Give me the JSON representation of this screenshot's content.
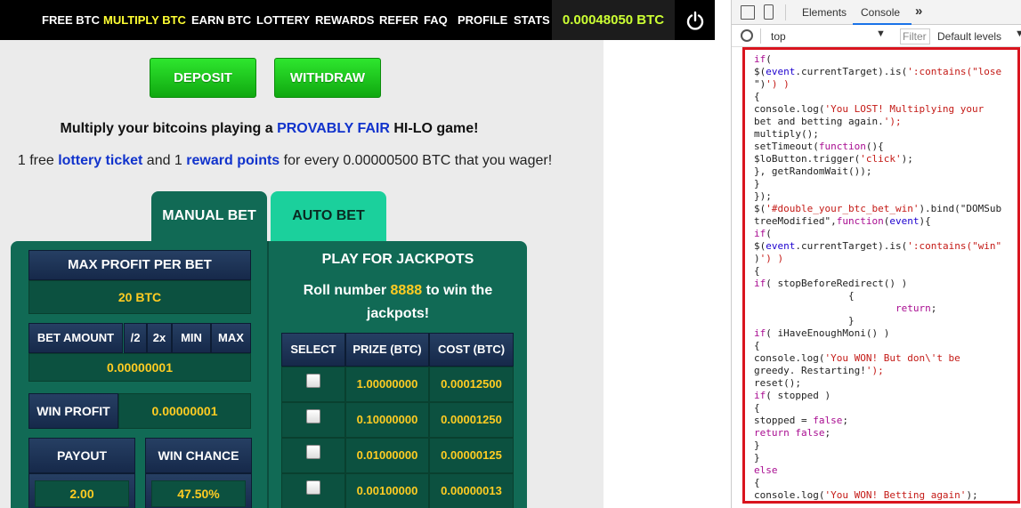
{
  "nav": {
    "items": [
      "FREE BTC",
      "MULTIPLY BTC",
      "EARN BTC",
      "LOTTERY",
      "REWARDS",
      "REFER",
      "FAQ",
      "PROFILE",
      "STATS"
    ],
    "active": "MULTIPLY BTC",
    "balance": "0.00048050 BTC"
  },
  "buttons": {
    "deposit": "DEPOSIT",
    "withdraw": "WITHDRAW"
  },
  "headline": {
    "pre": "Multiply your bitcoins playing a ",
    "highlight": "PROVABLY FAIR",
    "post": " HI-LO game!"
  },
  "subline": {
    "p1": "1 free ",
    "link1": "lottery ticket",
    "p2": " and 1 ",
    "link2": "reward points",
    "p3": " for every 0.00000500 BTC that you wager!"
  },
  "tabs": {
    "manual": "MANUAL BET",
    "auto": "AUTO BET"
  },
  "manual": {
    "max_profit_label": "MAX PROFIT PER BET",
    "max_profit_value": "20 BTC",
    "bet_amount_label": "BET AMOUNT",
    "bet_buttons": [
      "/2",
      "2x",
      "MIN",
      "MAX"
    ],
    "bet_amount_value": "0.00000001",
    "win_profit_label": "WIN PROFIT",
    "win_profit_value": "0.00000001",
    "payout_label": "PAYOUT",
    "payout_value": "2.00",
    "win_chance_label": "WIN CHANCE",
    "win_chance_value": "47.50%"
  },
  "jackpot": {
    "title": "PLAY FOR JACKPOTS",
    "line1_pre": "Roll number ",
    "line1_number": "8888",
    "line1_post": " to win the",
    "line2": "jackpots!",
    "headers": [
      "SELECT",
      "PRIZE (BTC)",
      "COST (BTC)"
    ],
    "rows": [
      {
        "prize": "1.00000000",
        "cost": "0.00012500"
      },
      {
        "prize": "0.10000000",
        "cost": "0.00001250"
      },
      {
        "prize": "0.01000000",
        "cost": "0.00000125"
      },
      {
        "prize": "0.00100000",
        "cost": "0.00000013"
      }
    ]
  },
  "devtools": {
    "tabs": [
      "Elements",
      "Console"
    ],
    "active_tab": "Console",
    "context": "top",
    "filter_placeholder": "Filter",
    "levels": "Default levels",
    "code_lines": [
      "if(",
      "$(event.currentTarget).is(':contains(\"lose",
      "\")') )",
      "{",
      "console.log('You LOST! Multiplying your",
      "bet and betting again.');",
      "multiply();",
      "setTimeout(function(){",
      "$loButton.trigger('click');",
      "}, getRandomWait());",
      "}",
      "});",
      "$('#double_your_btc_bet_win').bind(\"DOMSub",
      "treeModified\",function(event){",
      "if(",
      "$(event.currentTarget).is(':contains(\"win\"",
      ")') )",
      "{",
      "if( stopBeforeRedirect() )",
      "                {",
      "                        return;",
      "                }",
      "if( iHaveEnoughMoni() )",
      "{",
      "console.log('You WON! But don\\'t be",
      "greedy. Restarting!');",
      "reset();",
      "if( stopped )",
      "{",
      "stopped = false;",
      "return false;",
      "}",
      "}",
      "else",
      "{",
      "console.log('You WON! Betting again');"
    ]
  }
}
